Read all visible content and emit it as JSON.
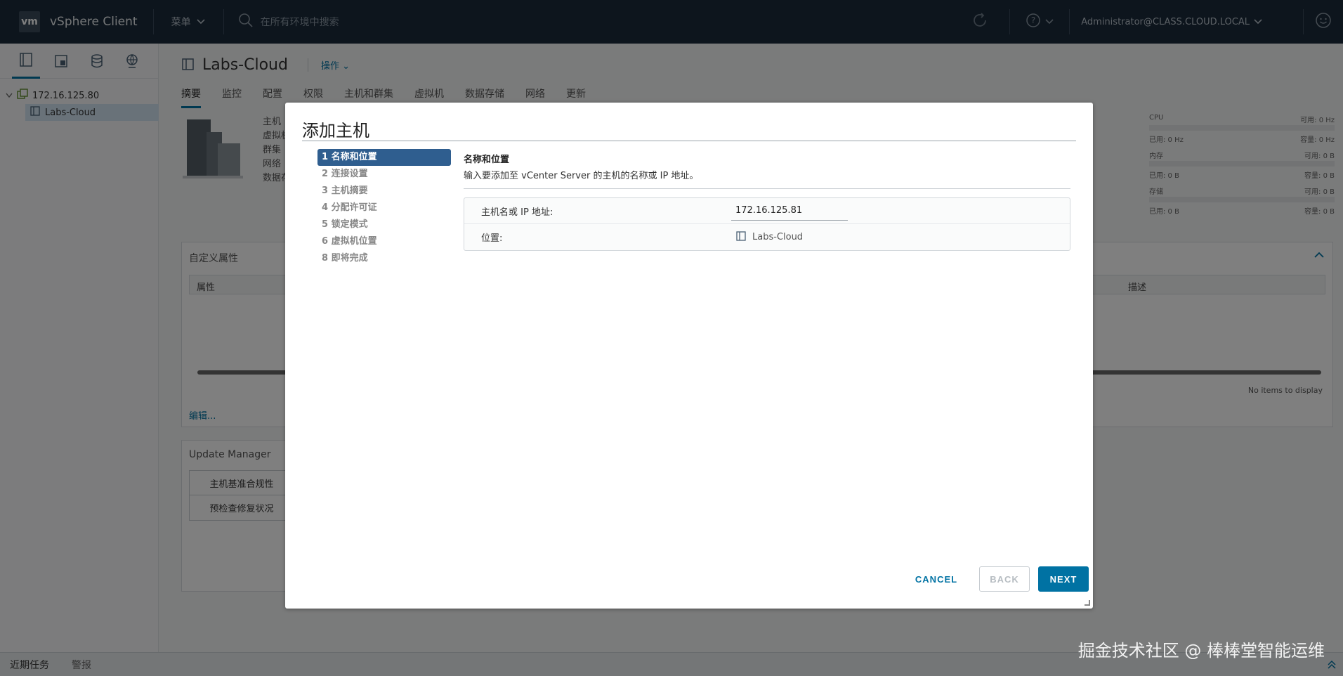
{
  "header": {
    "app_title": "vSphere Client",
    "menu_label": "菜单",
    "search_placeholder": "在所有环境中搜索",
    "user": "Administrator@CLASS.CLOUD.LOCAL"
  },
  "tree": {
    "root": "172.16.125.80",
    "child": "Labs-Cloud"
  },
  "object": {
    "title": "Labs-Cloud",
    "actions_label": "操作"
  },
  "tabs": [
    "摘要",
    "监控",
    "配置",
    "权限",
    "主机和群集",
    "虚拟机",
    "数据存储",
    "网络",
    "更新"
  ],
  "summary_labels": [
    "主机",
    "虚拟机",
    "群集",
    "网络",
    "数据存"
  ],
  "resources": {
    "cpu_label": "CPU",
    "cpu_free": "可用: 0 Hz",
    "cpu_used": "已用: 0 Hz",
    "cpu_capacity": "容量: 0 Hz",
    "mem_label": "内存",
    "mem_free": "可用: 0 B",
    "mem_used": "已用: 0 B",
    "mem_capacity": "容量: 0 B",
    "storage_label": "存储",
    "storage_free": "可用: 0 B",
    "storage_used": "已用: 0 B",
    "storage_capacity": "容量: 0 B"
  },
  "custom_attrs": {
    "title": "自定义属性",
    "col_attr": "属性",
    "col_desc": "描述",
    "empty": "No items to display",
    "edit": "编辑..."
  },
  "update_manager": {
    "title": "Update Manager",
    "btn1": "主机基准合规性",
    "btn2": "预检查修复状况"
  },
  "bottom": {
    "recent_tasks": "近期任务",
    "alarms": "警报"
  },
  "watermark": "掘金技术社区 @ 棒棒堂智能运维",
  "dialog": {
    "title": "添加主机",
    "steps": [
      {
        "label": "1 名称和位置",
        "active": true
      },
      {
        "label": "2 连接设置",
        "active": false
      },
      {
        "label": "3 主机摘要",
        "active": false
      },
      {
        "label": "4 分配许可证",
        "active": false
      },
      {
        "label": "5 锁定模式",
        "active": false
      },
      {
        "label": "6 虚拟机位置",
        "active": false
      },
      {
        "label": "8 即将完成",
        "active": false
      }
    ],
    "section_title": "名称和位置",
    "section_desc": "输入要添加至 vCenter Server 的主机的名称或 IP 地址。",
    "host_label": "主机名或 IP 地址:",
    "host_value": "172.16.125.81",
    "location_label": "位置:",
    "location_value": "Labs-Cloud",
    "cancel": "CANCEL",
    "back": "BACK",
    "next": "NEXT"
  }
}
